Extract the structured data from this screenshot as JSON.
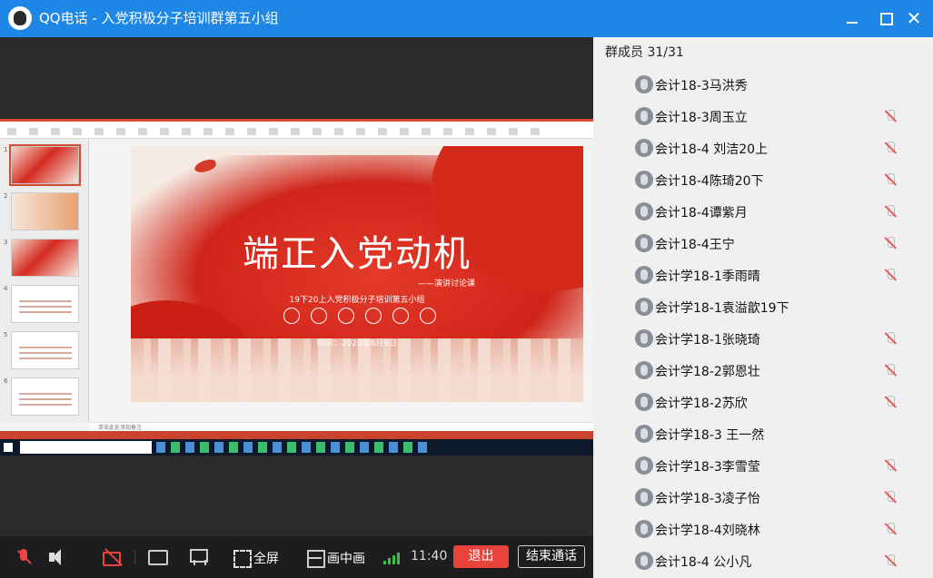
{
  "window": {
    "title": "QQ电话 - 入党积极分子培训群第五小组",
    "icons": [
      "qq-logo-icon",
      "minimize-icon",
      "maximize-icon",
      "close-icon"
    ]
  },
  "shared_slide": {
    "heading": "端正入党动机",
    "subtitle": "——演讲讨论课",
    "group_line": "19下20上入党积极分子培训第五小组",
    "date_line": "时间：2020年6月9日",
    "thumbnail_numbers": [
      "1",
      "2",
      "3",
      "4",
      "5",
      "6"
    ],
    "notes_placeholder": "单击此处添加备注"
  },
  "controls": {
    "fullscreen_label": "全屏",
    "pip_label": "画中画",
    "timer": "11:40",
    "exit_label": "退出",
    "end_call_label": "结束通话",
    "signal_color": "#39c24a",
    "exit_color": "#e9433d"
  },
  "members": {
    "header": "群成员 31/31",
    "list": [
      {
        "name": "会计18-3马洪秀",
        "muted": false
      },
      {
        "name": "会计18-3周玉立",
        "muted": true
      },
      {
        "name": "会计18-4 刘洁20上",
        "muted": true
      },
      {
        "name": "会计18-4陈琦20下",
        "muted": true
      },
      {
        "name": "会计18-4谭紫月",
        "muted": true
      },
      {
        "name": "会计18-4王宁",
        "muted": true
      },
      {
        "name": "会计学18-1季雨晴",
        "muted": true
      },
      {
        "name": "会计学18-1袁溢歆19下",
        "muted": false
      },
      {
        "name": "会计学18-1张晓琦",
        "muted": true
      },
      {
        "name": "会计学18-2郭恩壮",
        "muted": true
      },
      {
        "name": "会计学18-2苏欣",
        "muted": true
      },
      {
        "name": "会计学18-3 王一然",
        "muted": false
      },
      {
        "name": "会计学18-3李雪莹",
        "muted": true
      },
      {
        "name": "会计学18-3凌子怡",
        "muted": true
      },
      {
        "name": "会计学18-4刘晓林",
        "muted": true
      },
      {
        "name": "会计18-4 公小凡",
        "muted": true
      }
    ]
  }
}
